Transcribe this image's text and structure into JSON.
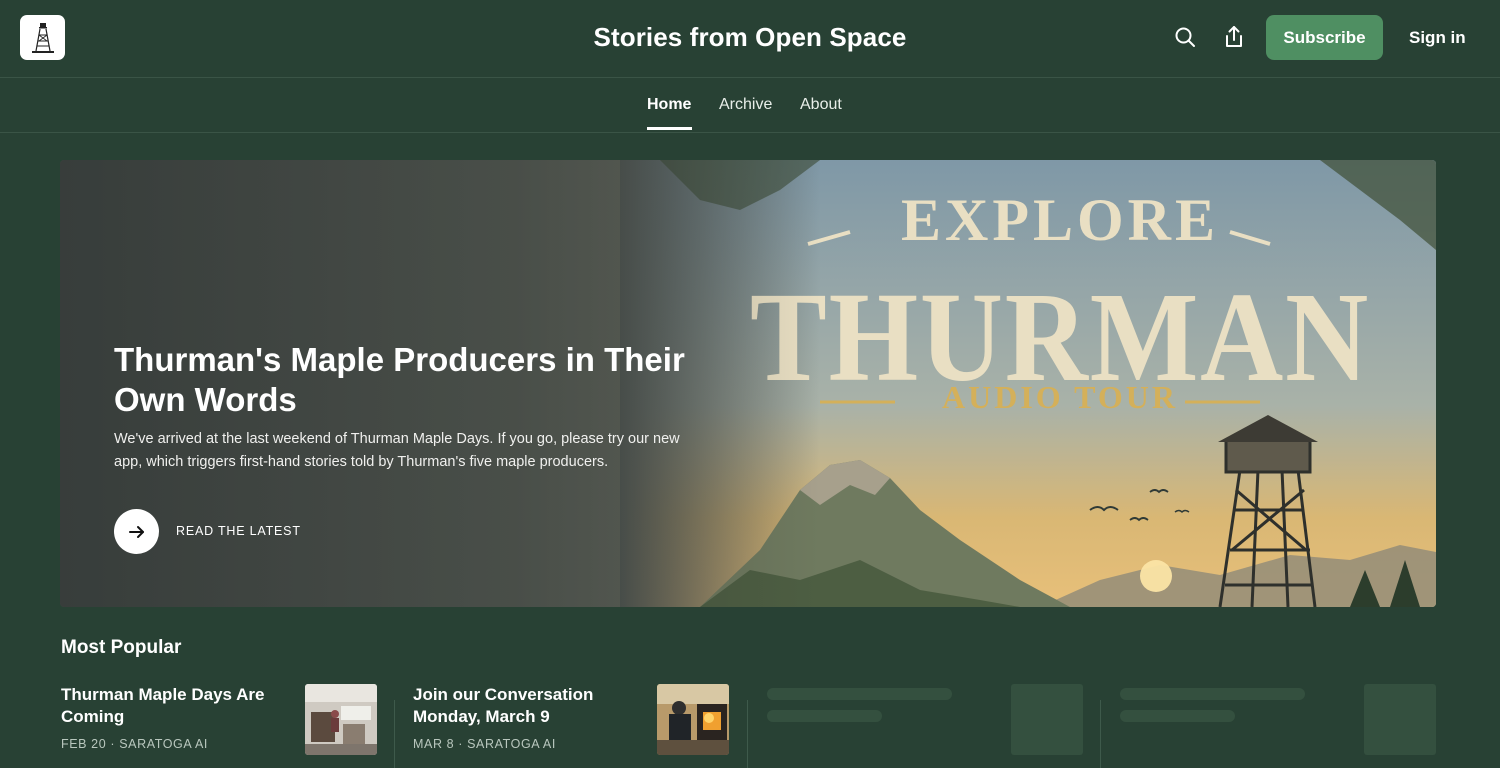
{
  "header": {
    "title": "Stories from Open Space",
    "subscribe_label": "Subscribe",
    "signin_label": "Sign in"
  },
  "nav": {
    "items": [
      {
        "label": "Home",
        "active": true
      },
      {
        "label": "Archive",
        "active": false
      },
      {
        "label": "About",
        "active": false
      }
    ]
  },
  "hero": {
    "title": "Thurman's Maple Producers in Their Own Words",
    "description": "We've arrived at the last weekend of Thurman Maple Days. If you go, please try our new app, which triggers first-hand stories told by Thurman's five maple producers.",
    "cta_label": "READ THE LATEST",
    "art_line1": "EXPLORE",
    "art_line2": "THURMAN",
    "art_line3": "AUDIO TOUR"
  },
  "most_popular": {
    "title": "Most Popular",
    "posts": [
      {
        "title": "Thurman Maple Days Are Coming",
        "meta": "FEB 20 · SARATOGA AI"
      },
      {
        "title": "Join our Conversation Monday, March 9",
        "meta": "MAR 8 · SARATOGA AI"
      }
    ]
  },
  "colors": {
    "background": "#284134",
    "subscribe": "#4f8f62",
    "art_text": "#e9dfc3",
    "art_accent": "#d4b05a"
  },
  "icons": {
    "logo": "fire-tower-logo-icon",
    "search": "search-icon",
    "share": "share-icon",
    "cta": "arrow-right-icon"
  }
}
